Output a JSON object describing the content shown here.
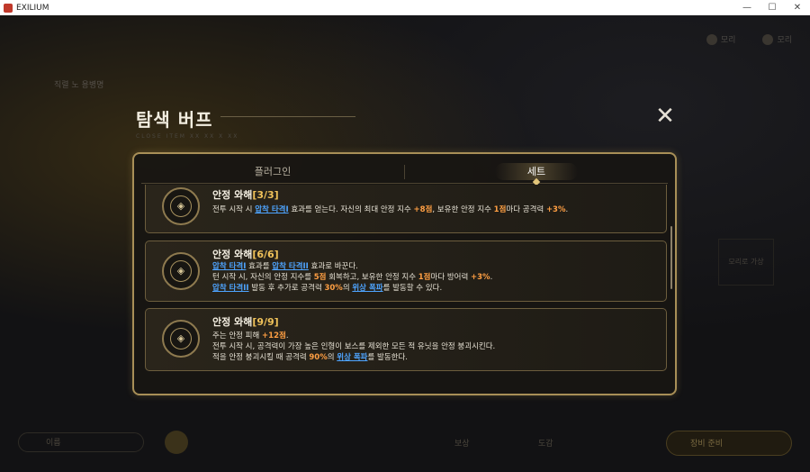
{
  "window": {
    "title": "EXILIUM",
    "minimize": "—",
    "maximize": "☐",
    "close": "✕"
  },
  "background": {
    "top_left": "직렬 노 용병명",
    "top_right": [
      "모리",
      "모리"
    ],
    "right_mid": "모리로 가상",
    "bottom_items": [
      "이름",
      "보상",
      "도감",
      "장비 준비"
    ]
  },
  "modal": {
    "title": "탐색 버프",
    "subtitle": "CLOSE  ITEM  XX  XX  X  XX",
    "close": "✕",
    "tabs": [
      {
        "label": "플러그인",
        "active": false
      },
      {
        "label": "세트",
        "active": true
      }
    ],
    "cards": [
      {
        "name": "안정 와해",
        "level": "[3/3]",
        "lines": [
          [
            {
              "t": "전투 시작 시 ",
              "k": "n"
            },
            {
              "t": "압착 타격I",
              "k": "l"
            },
            {
              "t": " 효과를 얻는다. 자신의 최대 안정 지수 ",
              "k": "n"
            },
            {
              "t": "+8점",
              "k": "h"
            },
            {
              "t": ", 보유한 안정 지수 ",
              "k": "n"
            },
            {
              "t": "1점",
              "k": "h"
            },
            {
              "t": "마다 공격력 ",
              "k": "n"
            },
            {
              "t": "+3%",
              "k": "h"
            },
            {
              "t": ".",
              "k": "n"
            }
          ]
        ]
      },
      {
        "name": "안정 와해",
        "level": "[6/6]",
        "lines": [
          [
            {
              "t": "압착 타격I",
              "k": "l"
            },
            {
              "t": " 효과를 ",
              "k": "n"
            },
            {
              "t": "압착 타격II",
              "k": "l"
            },
            {
              "t": " 효과로 바꾼다.",
              "k": "n"
            }
          ],
          [
            {
              "t": "턴 시작 시, 자신의 안정 지수를 ",
              "k": "n"
            },
            {
              "t": "5점",
              "k": "h"
            },
            {
              "t": " 회복하고, 보유한 안정 지수 ",
              "k": "n"
            },
            {
              "t": "1점",
              "k": "h"
            },
            {
              "t": "마다 방어력 ",
              "k": "n"
            },
            {
              "t": "+3%",
              "k": "h"
            },
            {
              "t": ".",
              "k": "n"
            }
          ],
          [
            {
              "t": "압착 타격II",
              "k": "l"
            },
            {
              "t": " 발동 후 추가로 공격력 ",
              "k": "n"
            },
            {
              "t": "30%",
              "k": "h"
            },
            {
              "t": "의 ",
              "k": "n"
            },
            {
              "t": "위상 폭파",
              "k": "l"
            },
            {
              "t": "를 발동할 수 있다.",
              "k": "n"
            }
          ]
        ]
      },
      {
        "name": "안정 와해",
        "level": "[9/9]",
        "lines": [
          [
            {
              "t": "주는 안정 피해 ",
              "k": "n"
            },
            {
              "t": "+12점",
              "k": "h"
            },
            {
              "t": ".",
              "k": "n"
            }
          ],
          [
            {
              "t": "전투 시작 시, 공격력이 가장 높은 인형이 보스를 제외한 모든 적 유닛을 안정 붕괴시킨다.",
              "k": "n"
            }
          ],
          [
            {
              "t": "적을 안정 붕괴시킬 때 공격력 ",
              "k": "n"
            },
            {
              "t": "90%",
              "k": "h"
            },
            {
              "t": "의 ",
              "k": "n"
            },
            {
              "t": "위상 폭파",
              "k": "l"
            },
            {
              "t": "를 발동한다.",
              "k": "n"
            }
          ]
        ]
      }
    ]
  },
  "colors": {
    "highlight": "#ff9f43",
    "link": "#4ea4ff",
    "gold": "#f0c25a"
  }
}
